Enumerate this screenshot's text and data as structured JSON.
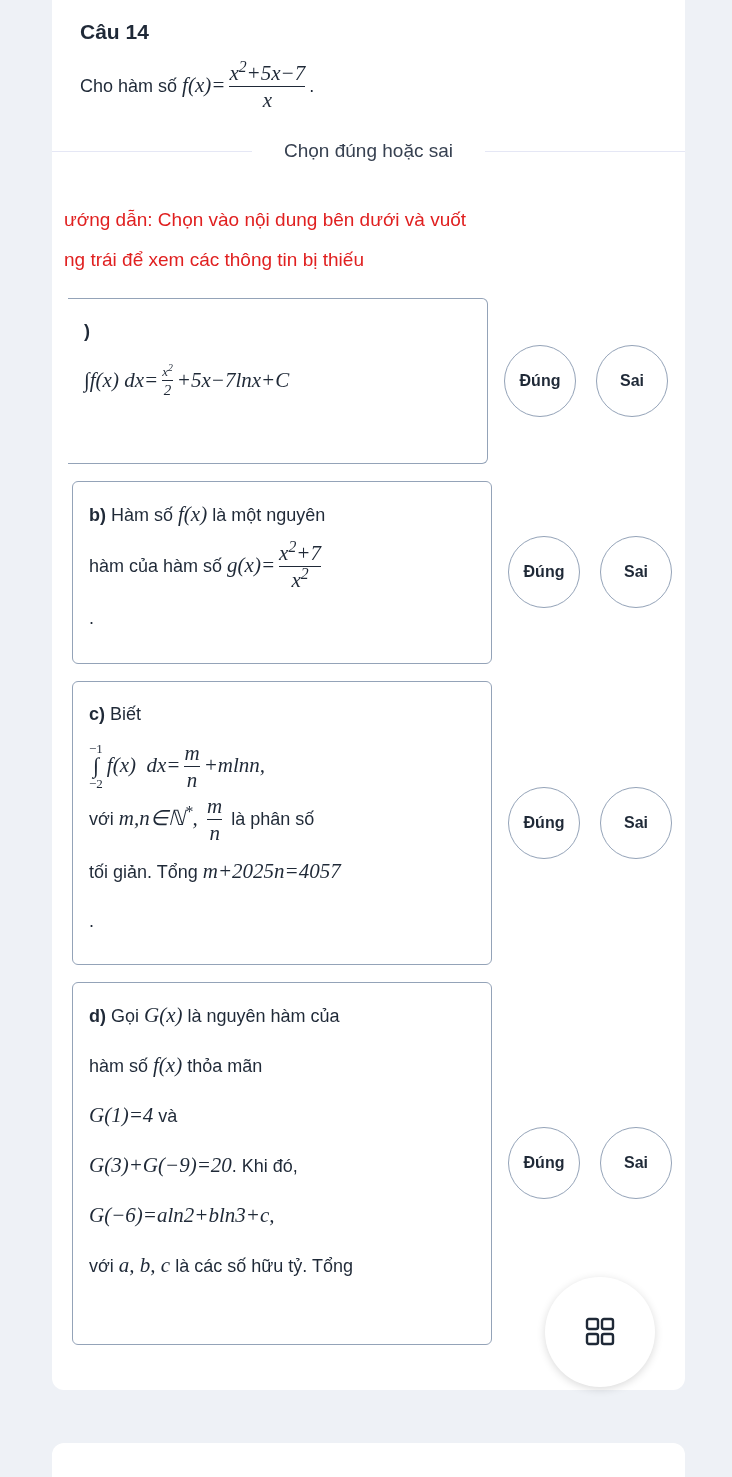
{
  "question": {
    "title": "Câu 14",
    "intro": [
      {
        "kind": "text",
        "text": "Cho hàm số "
      },
      {
        "kind": "math",
        "text": "f(x)="
      },
      {
        "kind": "frac",
        "num": "x$^{2}$+5x−7",
        "den": "x"
      },
      {
        "kind": "text",
        "text": "."
      }
    ],
    "mode_label": "Chọn đúng hoặc sai",
    "hint_lines": [
      "ướng dẫn: Chọn vào nội dung bên dưới và vuốt",
      "ng trái để xem các thông tin bị thiếu"
    ]
  },
  "statements": [
    {
      "lines": [
        [
          {
            "kind": "bold",
            "text": ")"
          }
        ],
        [
          {
            "kind": "math",
            "text": "∫f(x) dx="
          },
          {
            "kind": "sfrac",
            "num": "x$^{2}$",
            "den": "2"
          },
          {
            "kind": "math",
            "text": "+5x−7lnx+C"
          }
        ]
      ],
      "choices": [
        {
          "label": "Đúng",
          "selected": false
        },
        {
          "label": "Sai",
          "selected": false
        }
      ]
    },
    {
      "lines": [
        [
          {
            "kind": "bold",
            "text": "b)"
          },
          {
            "kind": "text",
            "text": " Hàm số "
          },
          {
            "kind": "math",
            "text": "f(x)"
          },
          {
            "kind": "text",
            "text": " là một nguyên"
          }
        ],
        [
          {
            "kind": "text",
            "text": "hàm của hàm số "
          },
          {
            "kind": "math",
            "text": "g(x)="
          },
          {
            "kind": "frac",
            "num": "x$^{2}$+7",
            "den": "x$^{2}$"
          }
        ],
        [
          {
            "kind": "text",
            "text": "."
          }
        ]
      ],
      "choices": [
        {
          "label": "Đúng",
          "selected": false
        },
        {
          "label": "Sai",
          "selected": false
        }
      ]
    },
    {
      "lines": [
        [
          {
            "kind": "bold",
            "text": "c)"
          },
          {
            "kind": "text",
            "text": " Biết"
          }
        ],
        [
          {
            "kind": "int",
            "sign": "∫",
            "upper": "−1",
            "lower": "−2"
          },
          {
            "kind": "math",
            "text": "f(x)  dx="
          },
          {
            "kind": "frac",
            "num": "m",
            "den": "n"
          },
          {
            "kind": "math",
            "text": "+mlnn,"
          }
        ],
        [
          {
            "kind": "text",
            "text": "với "
          },
          {
            "kind": "math",
            "text": "m,n∈ℕ$^{*}$, "
          },
          {
            "kind": "frac",
            "num": "m",
            "den": "n"
          },
          {
            "kind": "text",
            "text": " là phân số"
          }
        ],
        [
          {
            "kind": "text",
            "text": "tối giản. Tổng "
          },
          {
            "kind": "math",
            "text": "m+2025n=4057"
          }
        ],
        [
          {
            "kind": "text",
            "text": "."
          }
        ]
      ],
      "choices": [
        {
          "label": "Đúng",
          "selected": false
        },
        {
          "label": "Sai",
          "selected": false
        }
      ]
    },
    {
      "lines": [
        [
          {
            "kind": "bold",
            "text": "d)"
          },
          {
            "kind": "text",
            "text": " Gọi "
          },
          {
            "kind": "math",
            "text": "G(x)"
          },
          {
            "kind": "text",
            "text": " là nguyên hàm của"
          }
        ],
        [
          {
            "kind": "text",
            "text": "hàm số "
          },
          {
            "kind": "math",
            "text": "f(x)"
          },
          {
            "kind": "text",
            "text": " thỏa mãn"
          }
        ],
        [
          {
            "kind": "math",
            "text": "G(1)=4"
          },
          {
            "kind": "text",
            "text": " và"
          }
        ],
        [
          {
            "kind": "math",
            "text": "G(3)+G(−9)=20"
          },
          {
            "kind": "text",
            "text": ". Khi đó,"
          }
        ],
        [
          {
            "kind": "math",
            "text": "G(−6)=aln2+bln3+c,"
          }
        ],
        [
          {
            "kind": "text",
            "text": "với "
          },
          {
            "kind": "math",
            "text": "a, b, c"
          },
          {
            "kind": "text",
            "text": " là các số hữu tỷ. Tổng"
          }
        ]
      ],
      "choices": [
        {
          "label": "Đúng",
          "selected": false
        },
        {
          "label": "Sai",
          "selected": false
        }
      ]
    }
  ]
}
